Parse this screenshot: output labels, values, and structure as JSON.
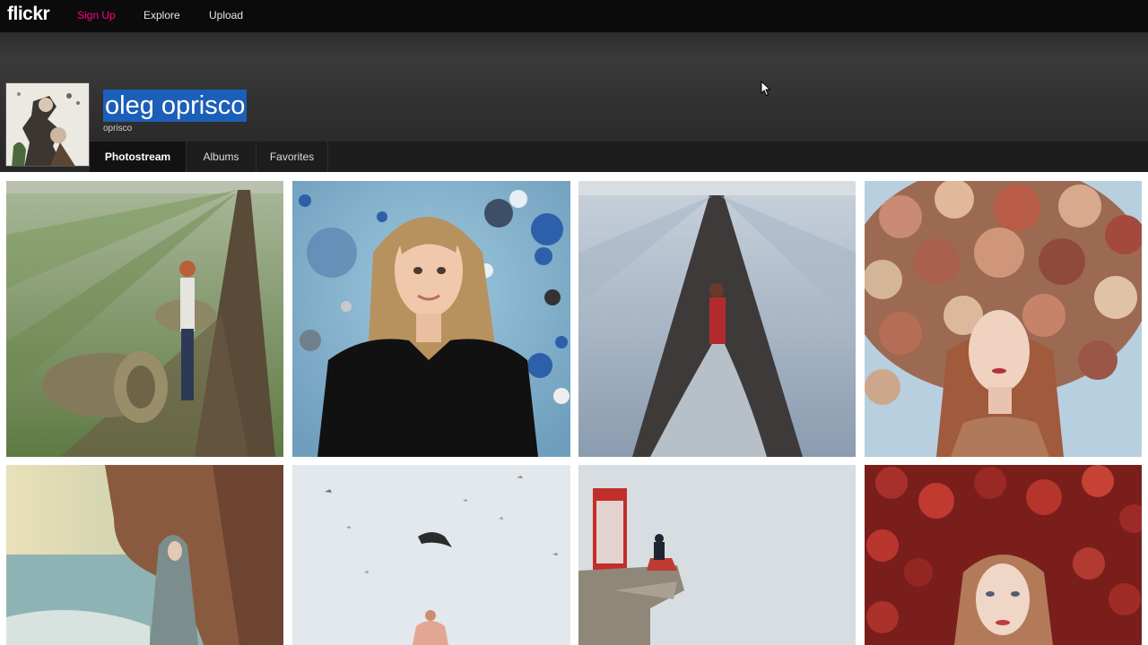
{
  "app": {
    "logo": "flickr"
  },
  "nav": {
    "signup": "Sign Up",
    "explore": "Explore",
    "upload": "Upload"
  },
  "profile": {
    "name": "oleg oprisco",
    "username": "oprisco"
  },
  "tabs": {
    "photostream": "Photostream",
    "albums": "Albums",
    "favorites": "Favorites"
  },
  "colors": {
    "signup": "#ff0084",
    "selection": "#1c5fb8",
    "nav_bg": "#0b0b0b"
  }
}
